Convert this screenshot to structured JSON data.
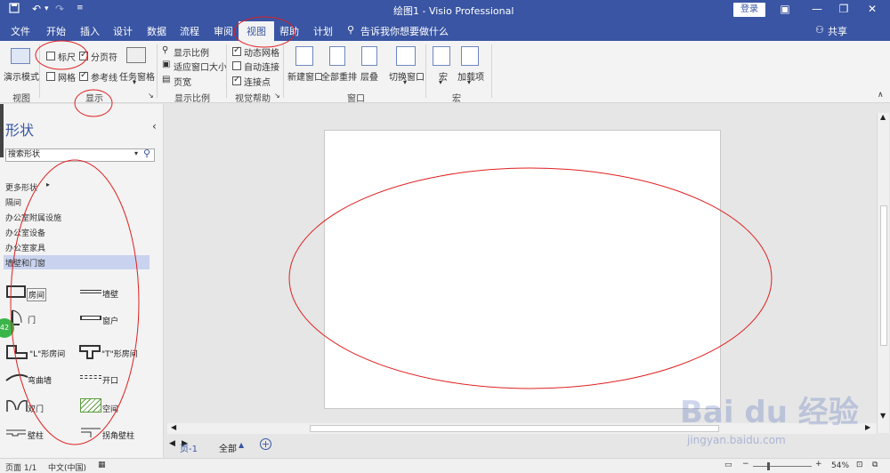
{
  "titlebar": {
    "title": "绘图1  -  Visio Professional",
    "signin": "登录"
  },
  "menu": {
    "tabs": [
      "文件",
      "开始",
      "插入",
      "设计",
      "数据",
      "流程",
      "审阅",
      "视图",
      "帮助",
      "计划"
    ],
    "active_index": 7,
    "tell_me": "告诉我你想要做什么",
    "share": "共享"
  },
  "ribbon": {
    "view_group": {
      "button": "演示模式",
      "label": "视图"
    },
    "show_group": {
      "label": "显示",
      "ruler": {
        "label": "标尺",
        "checked": false
      },
      "page_breaks": {
        "label": "分页符",
        "checked": true
      },
      "grid": {
        "label": "网格",
        "checked": false
      },
      "guides": {
        "label": "参考线",
        "checked": true
      },
      "task_panes": "任务窗格"
    },
    "zoom_group": {
      "label": "显示比例",
      "zoom": "显示比例",
      "fit": "适应窗口大小",
      "page_width": "页宽"
    },
    "visual_aids_group": {
      "label": "视觉帮助",
      "dynamic_grid": {
        "label": "动态网格",
        "checked": true
      },
      "autoconnect": {
        "label": "自动连接",
        "checked": false
      },
      "connection_points": {
        "label": "连接点",
        "checked": true
      }
    },
    "window_group": {
      "label": "窗口",
      "new_window": "新建窗口",
      "arrange_all": "全部重排",
      "cascade": "层叠",
      "switch_windows": "切换窗口"
    },
    "macro_group": {
      "label": "宏",
      "macros": "宏",
      "addins": "加载项"
    }
  },
  "shapes_pane": {
    "title": "形状",
    "search_placeholder": "搜索形状",
    "more_shapes": "更多形状",
    "categories": [
      "隔间",
      "办公室附属设施",
      "办公室设备",
      "办公室家具",
      "墙壁和门窗"
    ],
    "selected_category": "墙壁和门窗",
    "shapes": [
      "房间",
      "墙壁",
      "门",
      "窗户",
      "\"L\"形房间",
      "\"T\"形房间",
      "弯曲墙",
      "开口",
      "双门",
      "空间",
      "壁柱",
      "拐角壁柱"
    ]
  },
  "sheet_tabs": {
    "page": "页-1",
    "all": "全部"
  },
  "statusbar": {
    "page": "页面 1/1",
    "language": "中文(中国)",
    "zoom": "54%"
  },
  "badge": {
    "value": "42"
  },
  "watermark": {
    "brand": "Bai du 经验",
    "url": "jingyan.baidu.com"
  },
  "colors": {
    "brand": "#3955a3",
    "annotation": "#e02020"
  }
}
